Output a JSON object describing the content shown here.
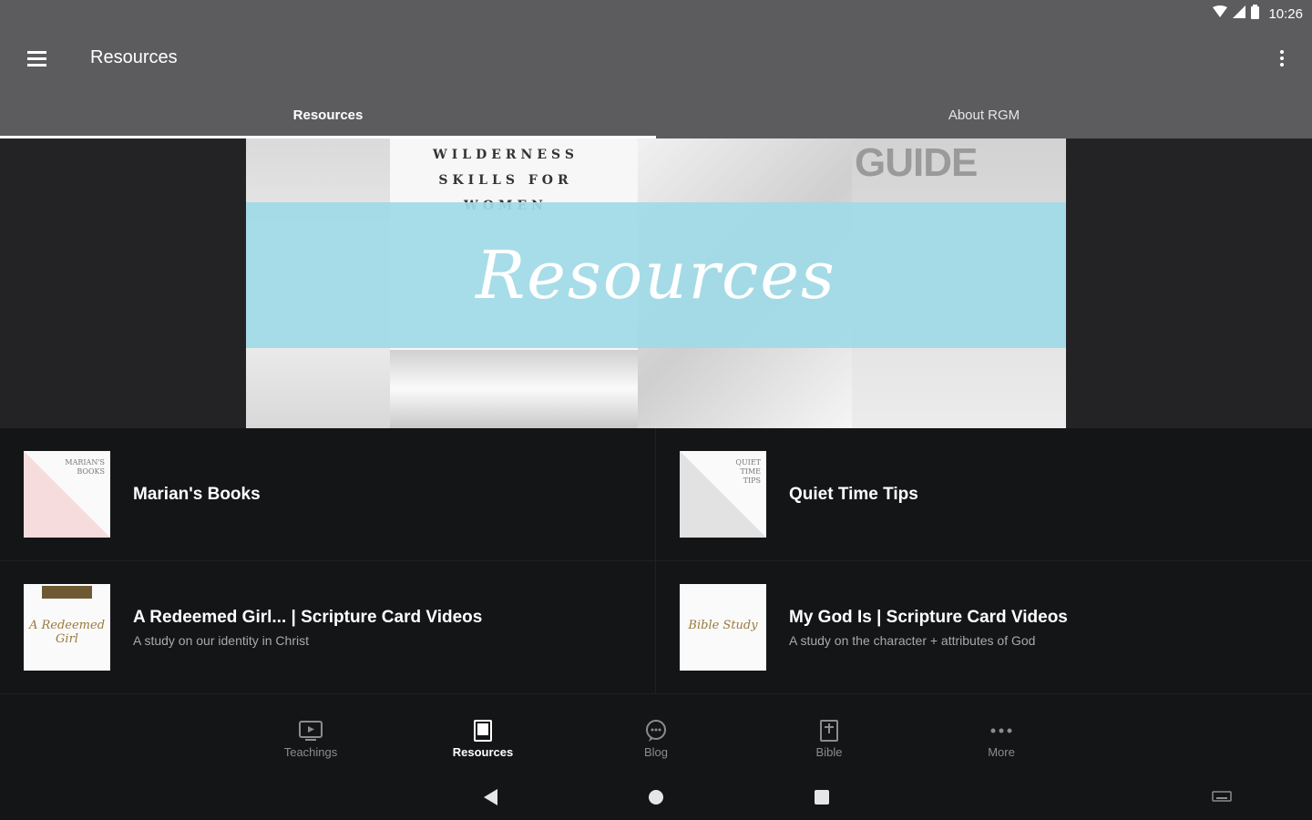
{
  "status_bar": {
    "time": "10:26"
  },
  "app_bar": {
    "title": "Resources"
  },
  "tabs": [
    {
      "label": "Resources",
      "active": true
    },
    {
      "label": "About RGM",
      "active": false
    }
  ],
  "hero": {
    "banner_text": "Resources",
    "book_text": "WILDERNESS\nSKILLS FOR\nWOMEN",
    "guide_text": "GUIDE"
  },
  "resources": [
    {
      "title": "Marian's Books",
      "subtitle": ""
    },
    {
      "title": "Quiet Time Tips",
      "subtitle": ""
    },
    {
      "title": "A Redeemed Girl... | Scripture Card Videos",
      "subtitle": "A study on our identity in Christ"
    },
    {
      "title": "My God Is | Scripture Card Videos",
      "subtitle": "A study on the character + attributes of God"
    }
  ],
  "bottom_nav": [
    {
      "label": "Teachings",
      "icon": "tv-icon",
      "active": false
    },
    {
      "label": "Resources",
      "icon": "book-icon",
      "active": true
    },
    {
      "label": "Blog",
      "icon": "chat-bubble-icon",
      "active": false
    },
    {
      "label": "Bible",
      "icon": "bible-icon",
      "active": false
    },
    {
      "label": "More",
      "icon": "more-horizontal-icon",
      "active": false
    }
  ],
  "colors": {
    "app_bar": "#5c5c5e",
    "background": "#141517",
    "banner": "#a0dae6"
  }
}
